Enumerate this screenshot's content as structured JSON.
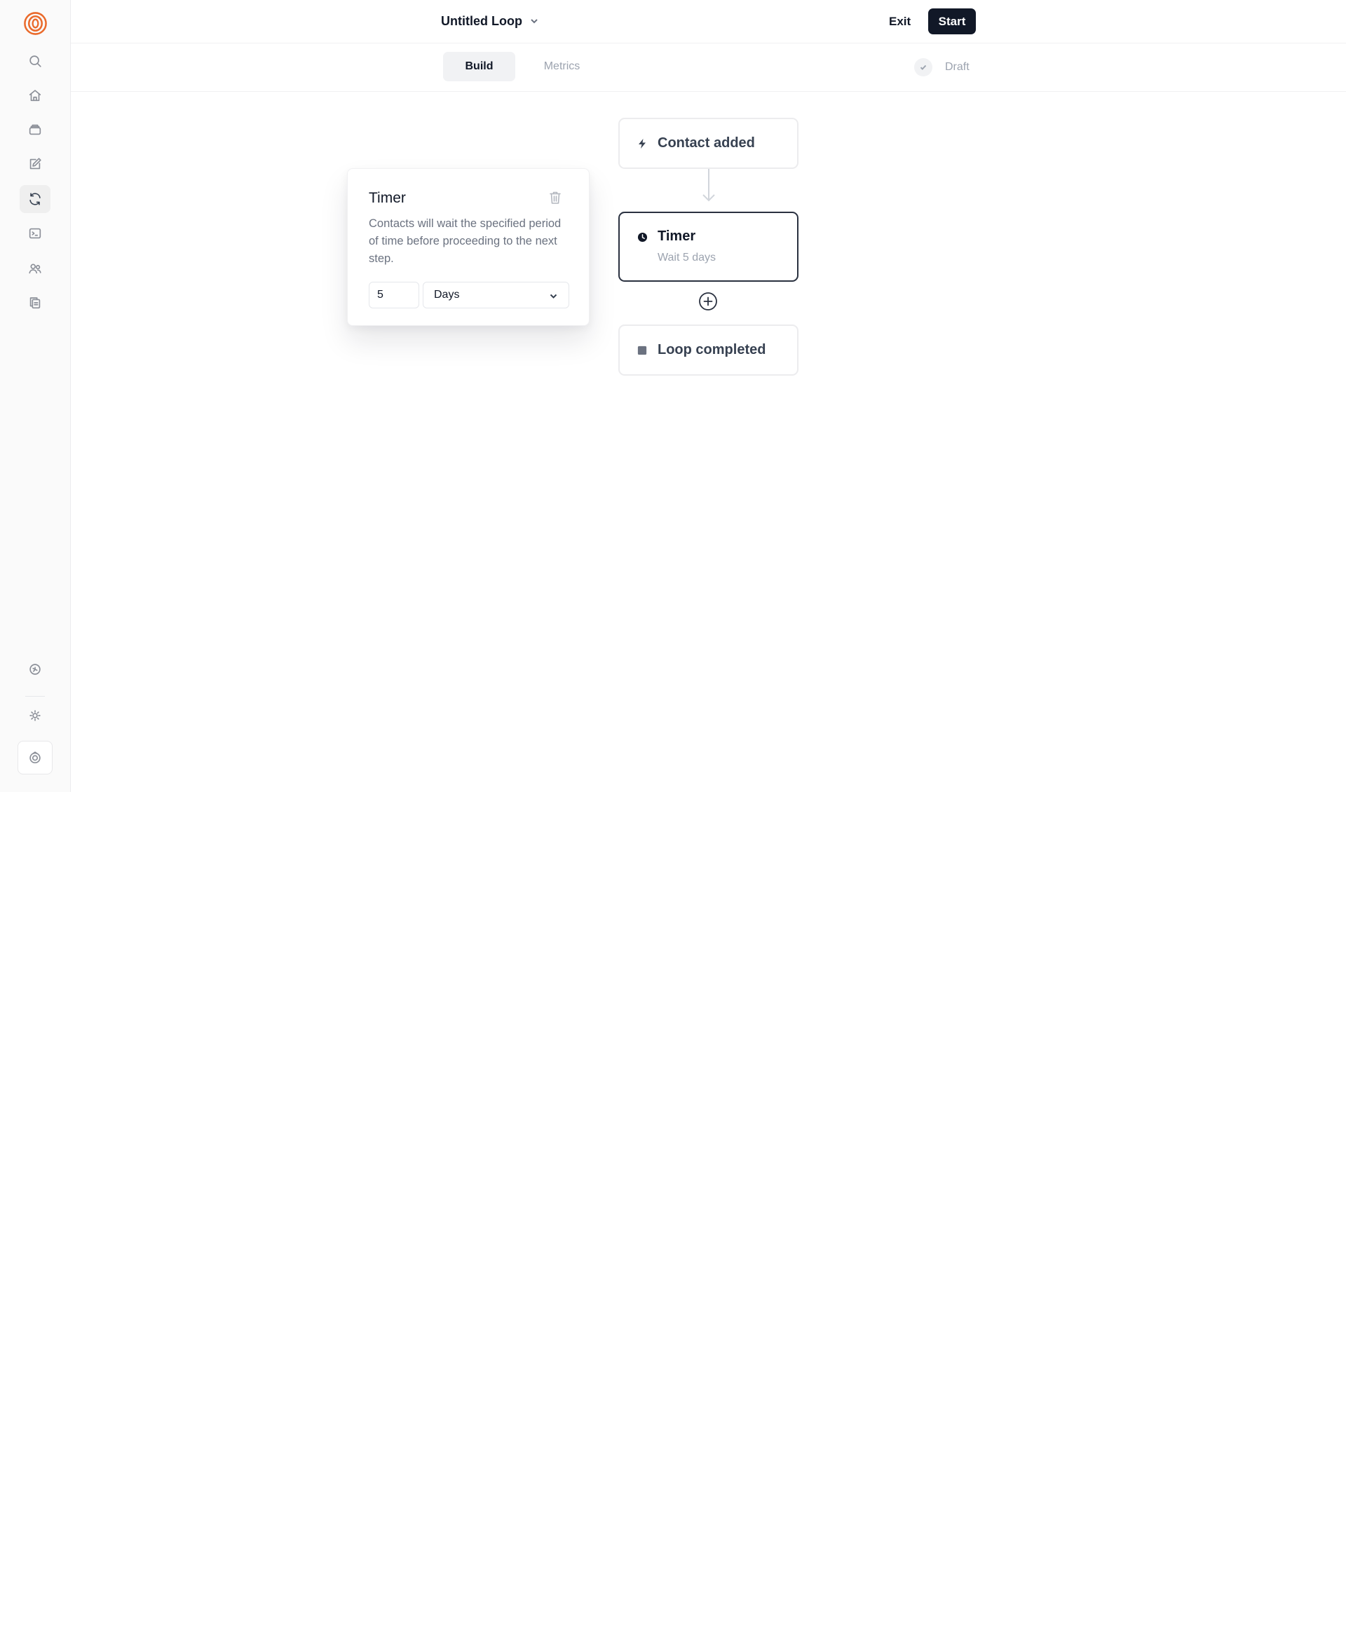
{
  "colors": {
    "brand": "#ea6a2b",
    "primary_button": "#111827",
    "selected_node_border": "#2a3140"
  },
  "sidebar": {
    "logo_icon": "loop-spiral-logo",
    "items": [
      {
        "icon": "search-icon",
        "active": false
      },
      {
        "icon": "home-icon",
        "active": false
      },
      {
        "icon": "inbox-icon",
        "active": false
      },
      {
        "icon": "edit-icon",
        "active": false
      },
      {
        "icon": "loops-refresh-icon",
        "active": true
      },
      {
        "icon": "terminal-icon",
        "active": false
      },
      {
        "icon": "users-icon",
        "active": false
      },
      {
        "icon": "copy-documents-icon",
        "active": false
      }
    ],
    "bottom_items": [
      {
        "icon": "help-circle-icon"
      },
      {
        "icon": "sun-theme-icon"
      },
      {
        "icon": "account-avatar-icon"
      }
    ]
  },
  "header": {
    "title": "Untitled Loop",
    "exit_label": "Exit",
    "start_label": "Start"
  },
  "subheader": {
    "tabs": [
      {
        "label": "Build",
        "active": true
      },
      {
        "label": "Metrics",
        "active": false
      }
    ],
    "status": "Draft"
  },
  "flow": {
    "trigger": {
      "title": "Contact added",
      "icon": "lightning-icon"
    },
    "timer": {
      "title": "Timer",
      "subtitle": "Wait 5 days",
      "icon": "clock-icon"
    },
    "end": {
      "title": "Loop completed",
      "icon": "stop-square-icon"
    }
  },
  "popover": {
    "title": "Timer",
    "description": "Contacts will wait the specified period of time before proceeding to the next step.",
    "amount": "5",
    "unit": "Days"
  }
}
